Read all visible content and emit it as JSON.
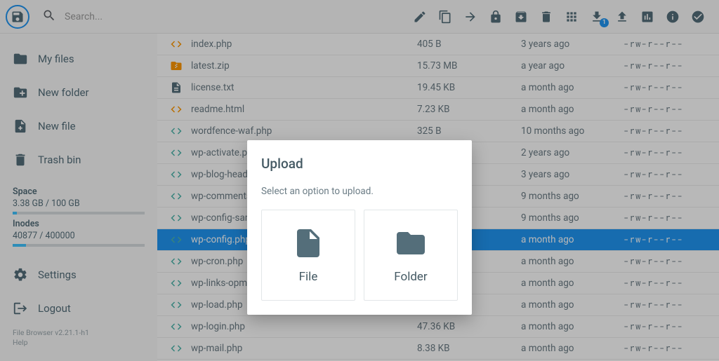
{
  "search": {
    "placeholder": "Search..."
  },
  "toolbar": {
    "download_badge": "1"
  },
  "sidebar": {
    "nav": [
      {
        "label": "My files"
      },
      {
        "label": "New folder"
      },
      {
        "label": "New file"
      },
      {
        "label": "Trash bin"
      }
    ],
    "space_label": "Space",
    "space_value": "3.38 GB / 100 GB",
    "space_pct": 3.4,
    "inodes_label": "Inodes",
    "inodes_value": "40877 / 400000",
    "inodes_pct": 10.2,
    "settings_label": "Settings",
    "logout_label": "Logout",
    "version": "File Browser v2.21.1-h1",
    "help": "Help"
  },
  "files": [
    {
      "icon": "code-orange",
      "name": "index.php",
      "size": "405 B",
      "time": "3 years ago",
      "perm": "-rw-r--r--",
      "selected": false
    },
    {
      "icon": "zip",
      "name": "latest.zip",
      "size": "15.73 MB",
      "time": "a year ago",
      "perm": "-rw-r--r--",
      "selected": false
    },
    {
      "icon": "text",
      "name": "license.txt",
      "size": "19.45 KB",
      "time": "a month ago",
      "perm": "-rw-r--r--",
      "selected": false
    },
    {
      "icon": "code-orange",
      "name": "readme.html",
      "size": "7.23 KB",
      "time": "a month ago",
      "perm": "-rw-r--r--",
      "selected": false
    },
    {
      "icon": "code-teal",
      "name": "wordfence-waf.php",
      "size": "325 B",
      "time": "10 months ago",
      "perm": "-rw-r--r--",
      "selected": false
    },
    {
      "icon": "code-teal",
      "name": "wp-activate.php",
      "size": "",
      "time": "2 years ago",
      "perm": "-rw-r--r--",
      "selected": false
    },
    {
      "icon": "code-teal",
      "name": "wp-blog-header.php",
      "size": "",
      "time": "3 years ago",
      "perm": "-rw-r--r--",
      "selected": false
    },
    {
      "icon": "code-teal",
      "name": "wp-comments-post.php",
      "size": "",
      "time": "9 months ago",
      "perm": "-rw-r--r--",
      "selected": false
    },
    {
      "icon": "code-teal",
      "name": "wp-config-sample.php",
      "size": "",
      "time": "9 months ago",
      "perm": "-rw-r--r--",
      "selected": false
    },
    {
      "icon": "code-teal",
      "name": "wp-config.php",
      "size": "",
      "time": "a month ago",
      "perm": "-rw-r--r--",
      "selected": true
    },
    {
      "icon": "code-teal",
      "name": "wp-cron.php",
      "size": "",
      "time": "a month ago",
      "perm": "-rw-r--r--",
      "selected": false
    },
    {
      "icon": "code-teal",
      "name": "wp-links-opml.php",
      "size": "",
      "time": "a month ago",
      "perm": "-rw-r--r--",
      "selected": false
    },
    {
      "icon": "code-teal",
      "name": "wp-load.php",
      "size": "",
      "time": "a month ago",
      "perm": "-rw-r--r--",
      "selected": false
    },
    {
      "icon": "code-teal",
      "name": "wp-login.php",
      "size": "47.36 KB",
      "time": "a month ago",
      "perm": "-rw-r--r--",
      "selected": false
    },
    {
      "icon": "code-teal",
      "name": "wp-mail.php",
      "size": "8.38 KB",
      "time": "a month ago",
      "perm": "-rw-r--r--",
      "selected": false
    }
  ],
  "dialog": {
    "title": "Upload",
    "subtitle": "Select an option to upload.",
    "file_label": "File",
    "folder_label": "Folder"
  }
}
